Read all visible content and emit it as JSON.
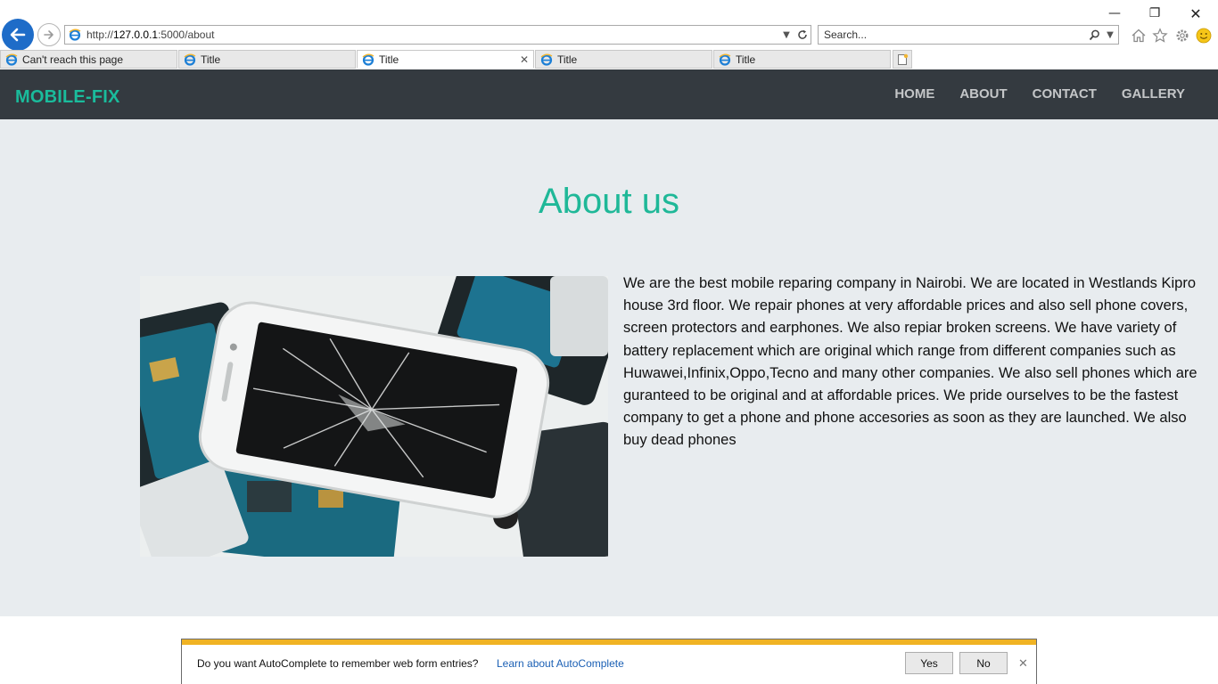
{
  "window": {
    "minimize": "—",
    "restore": "❐",
    "close": "✕"
  },
  "address_bar": {
    "url_prefix": "http://",
    "url_host": "127.0.0.1",
    "url_path": ":5000/about"
  },
  "search_bar": {
    "placeholder": "Search..."
  },
  "tabs": [
    {
      "title": "Can't reach this page",
      "active": false
    },
    {
      "title": "Title",
      "active": false
    },
    {
      "title": "Title",
      "active": true
    },
    {
      "title": "Title",
      "active": false
    },
    {
      "title": "Title",
      "active": false
    }
  ],
  "navbar": {
    "brand": "MOBILE-FIX",
    "links": [
      "HOME",
      "ABOUT",
      "CONTACT",
      "GALLERY"
    ]
  },
  "about": {
    "title": "About us",
    "paragraph": "We are the best mobile reparing company in Nairobi. We are located in Westlands Kipro house 3rd floor. We repair phones at very affordable prices and also sell phone covers, screen protectors and earphones. We also repiar broken screens. We have variety of battery replacement which are original which range from different companies such as Huwawei,Infinix,Oppo,Tecno and many other companies. We also sell phones which are guranteed to be original and at affordable prices. We pride ourselves to be the fastest company to get a phone and phone accesories as soon as they are launched. We also buy dead phones"
  },
  "autocomplete_bar": {
    "message": "Do you want AutoComplete to remember web form entries?",
    "link": "Learn about AutoComplete",
    "yes": "Yes",
    "no": "No",
    "close": "✕"
  },
  "colors": {
    "navbar_bg": "#343a40",
    "brand": "#1abc9c",
    "title": "#1fb898",
    "section_bg": "#e8ecef",
    "notif_stripe": "#f0b323"
  }
}
